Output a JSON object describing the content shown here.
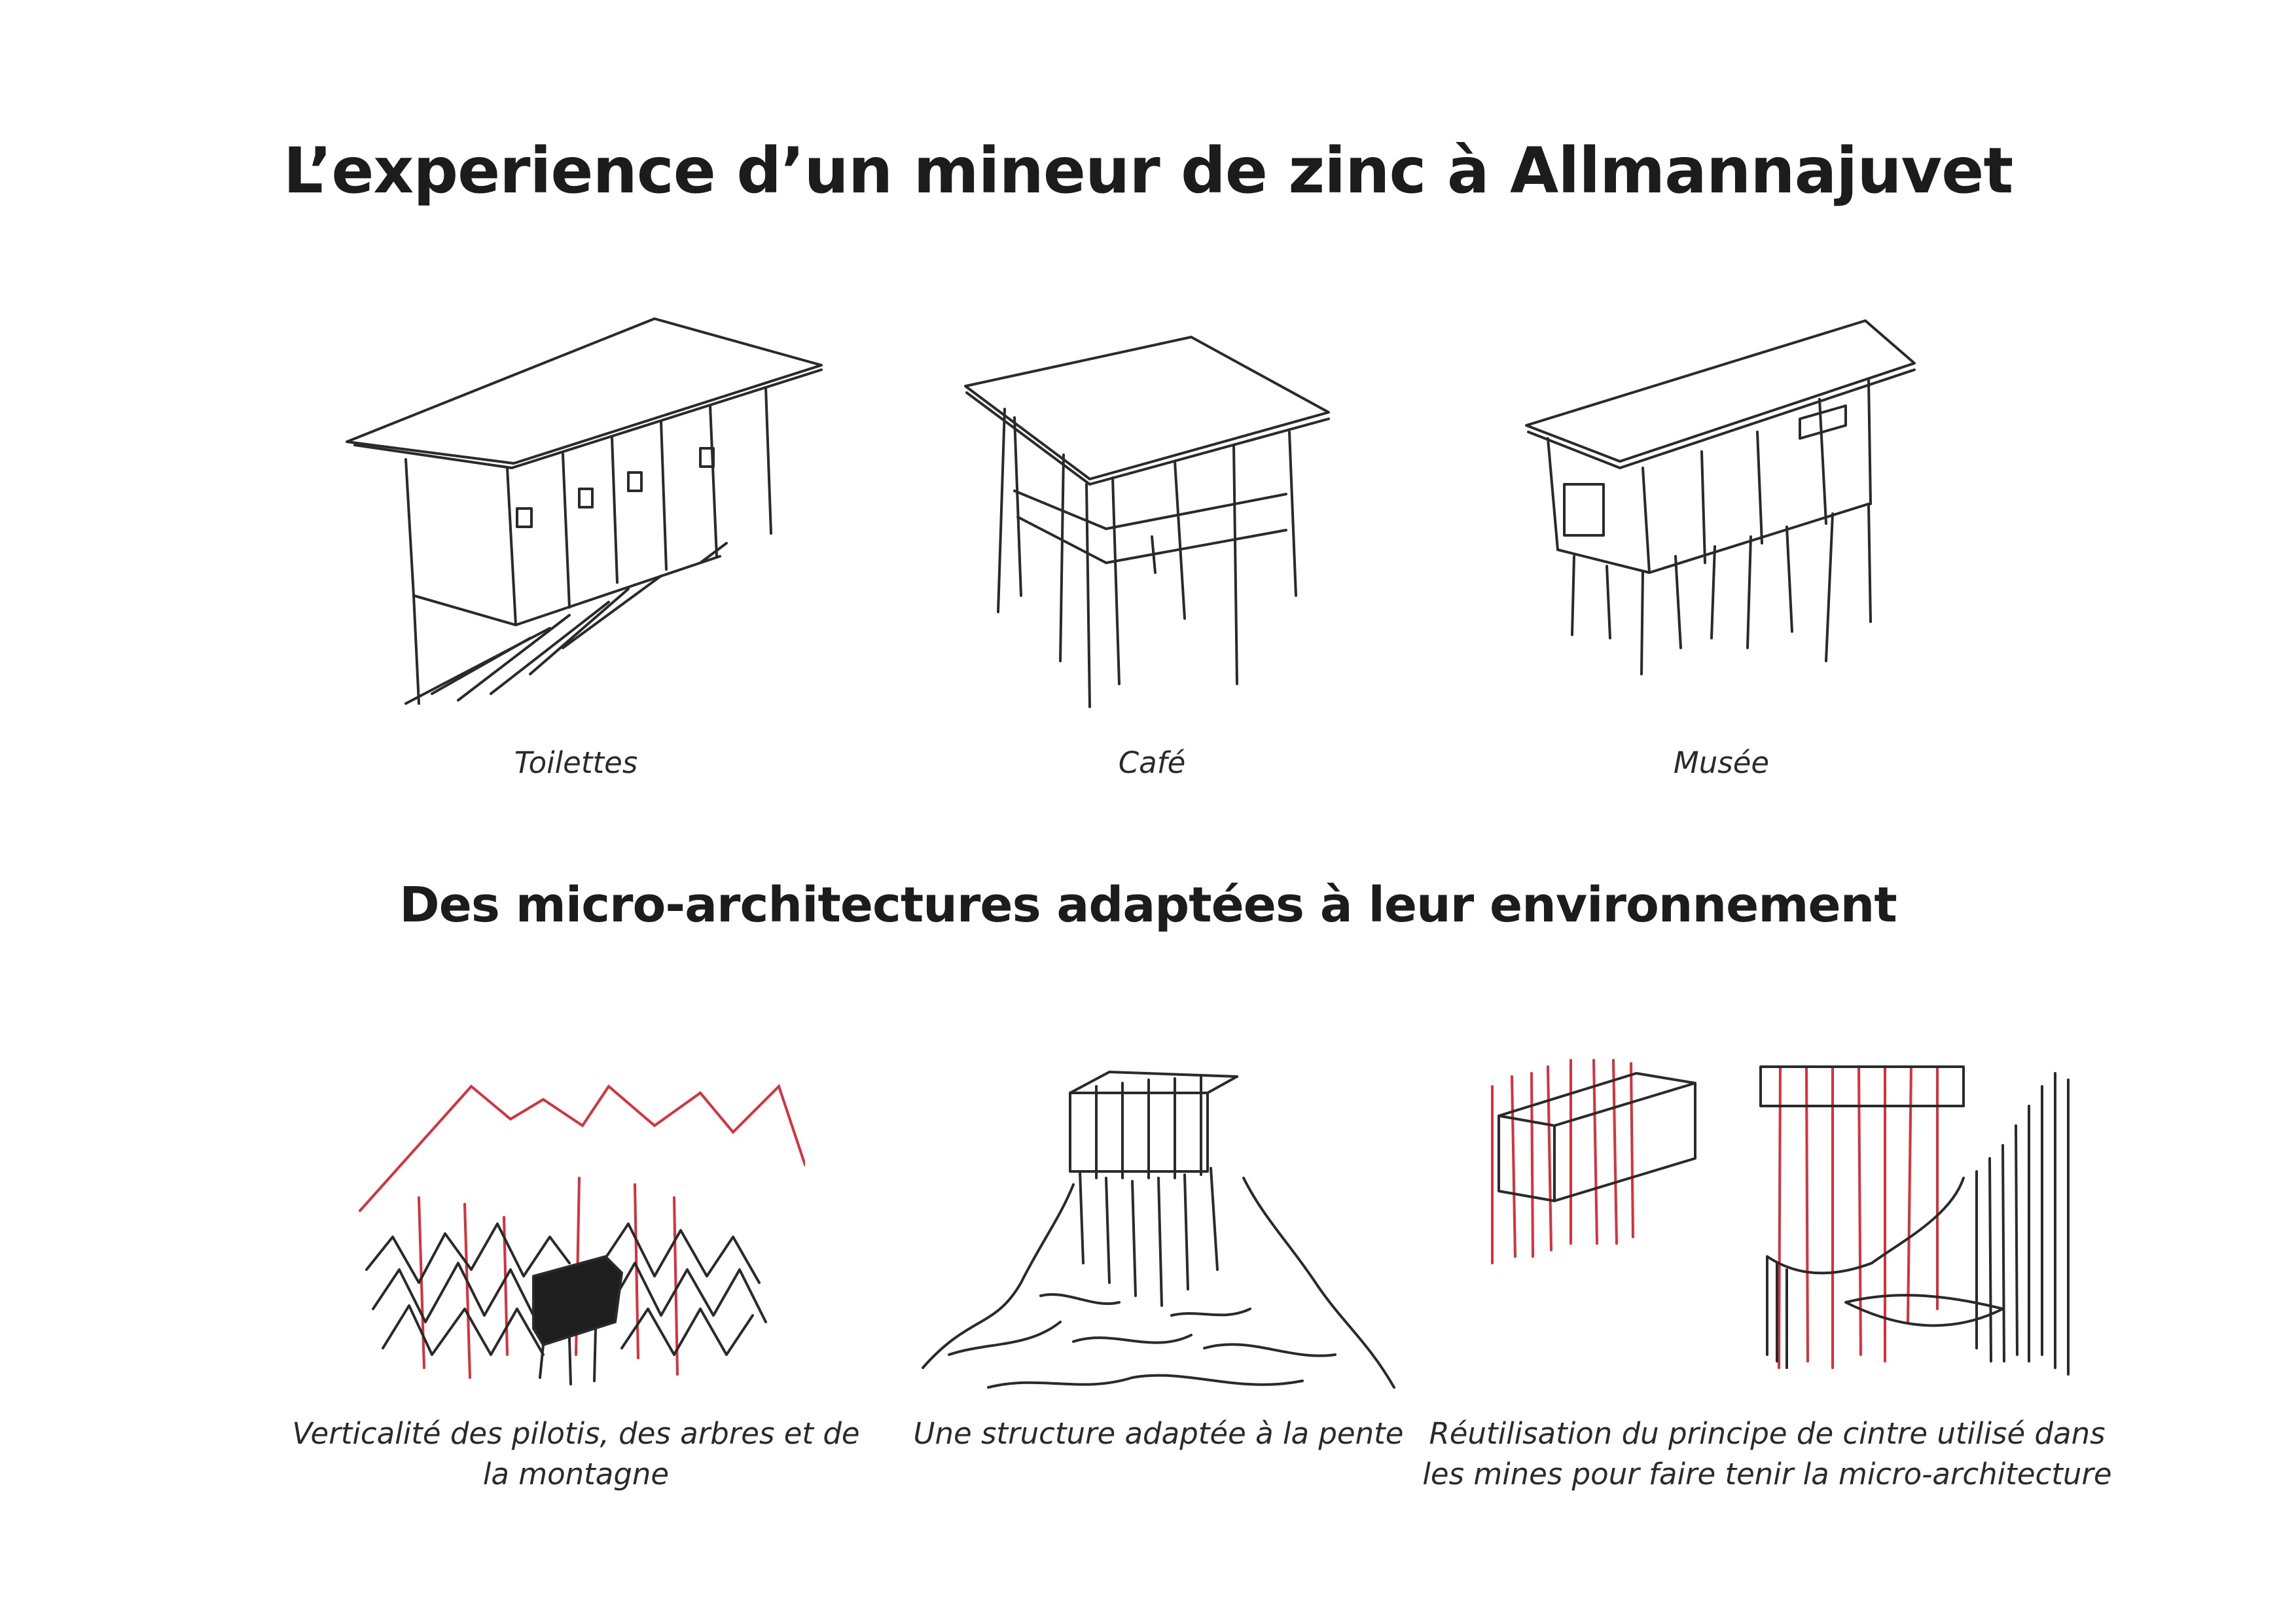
{
  "titles": {
    "main": "L’experience d’un mineur de zinc à Allmannajuvet",
    "sub": "Des micro-architectures adaptées à leur environnement"
  },
  "buildings": [
    {
      "caption": "Toilettes"
    },
    {
      "caption": "Café"
    },
    {
      "caption": "Musée"
    }
  ],
  "concepts": [
    {
      "caption_line1": "Verticalité des pilotis, des arbres et de",
      "caption_line2": "la montagne"
    },
    {
      "caption_line1": "Une structure adaptée à la pente",
      "caption_line2": ""
    },
    {
      "caption_line1": "Réutilisation du principe de cintre utilisé dans",
      "caption_line2": "les mines pour faire tenir la micro-architecture"
    }
  ],
  "colors": {
    "ink": "#2a2a2a",
    "accent_red": "#d9313b",
    "background": "#ffffff"
  }
}
